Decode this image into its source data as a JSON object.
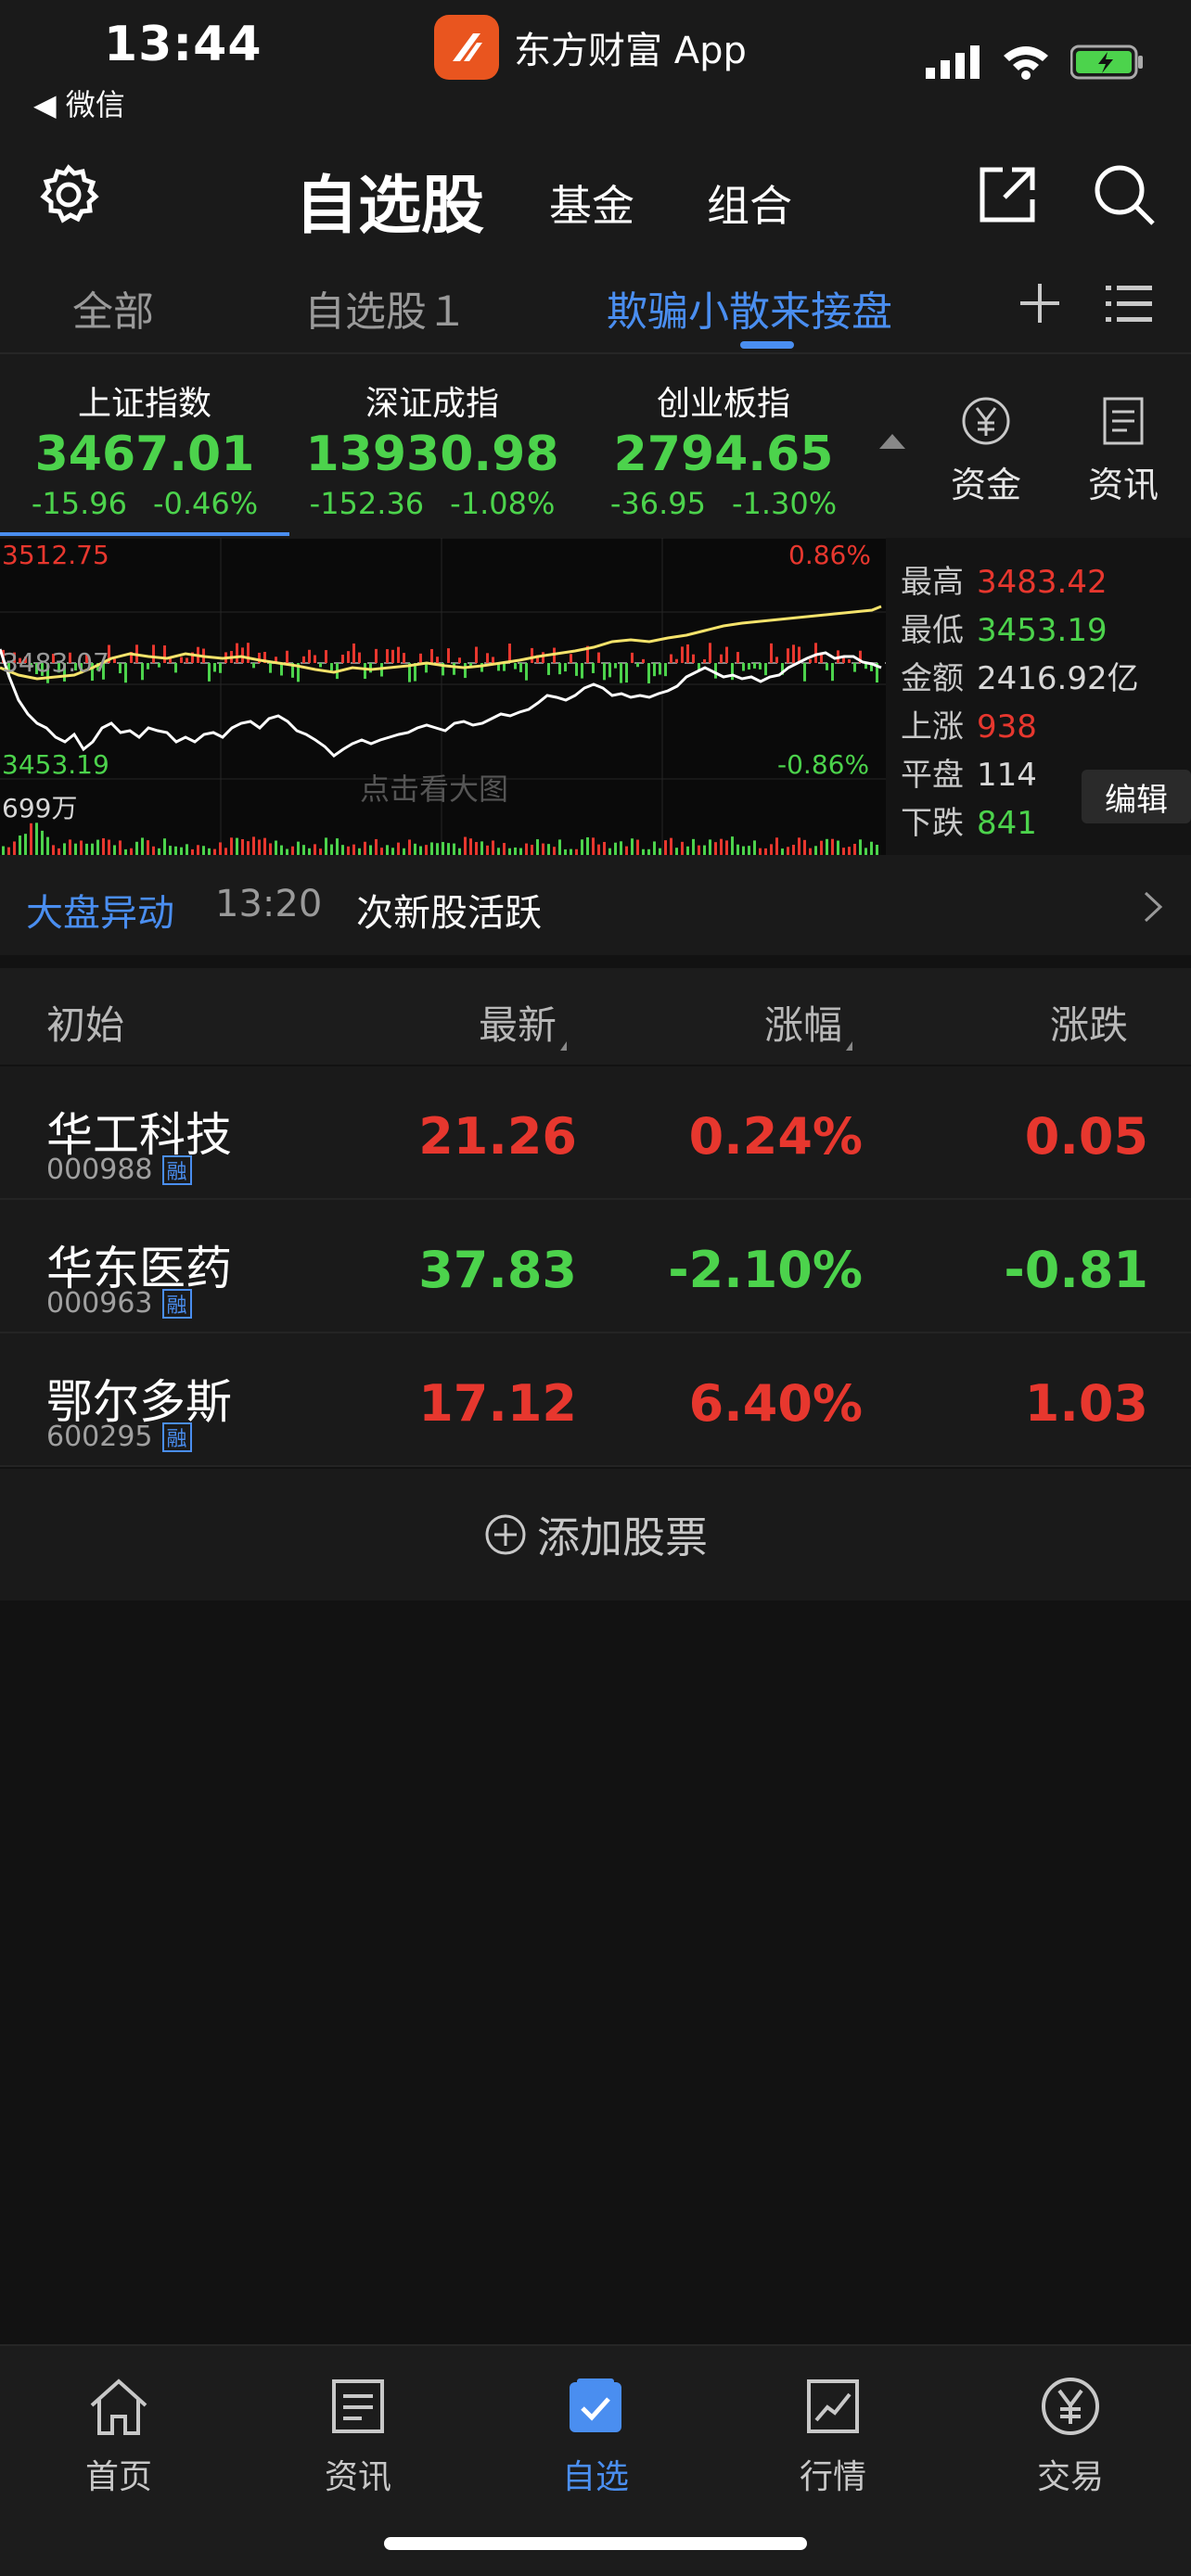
{
  "status_bar": {
    "time": "13:44",
    "back_label": "◀ 微信",
    "app_name": "东方财富 App"
  },
  "nav": {
    "title": "自选股",
    "tab_fund": "基金",
    "tab_portfolio": "组合"
  },
  "groups": {
    "all": "全部",
    "watch1": "自选股１",
    "active": "欺骗小散来接盘"
  },
  "indices": [
    {
      "name": "上证指数",
      "value": "3467.01",
      "change": "-15.96",
      "pct": "-0.46%"
    },
    {
      "name": "深证成指",
      "value": "13930.98",
      "change": "-152.36",
      "pct": "-1.08%"
    },
    {
      "name": "创业板指",
      "value": "2794.65",
      "change": "-36.95",
      "pct": "-1.30%"
    }
  ],
  "side_buttons": {
    "funds": "资金",
    "news": "资讯"
  },
  "chart": {
    "high_label": "3512.75",
    "mid_label": "3483.07",
    "low_label": "3453.19",
    "pct_high": "0.86%",
    "pct_low": "-0.86%",
    "volume_label": "699万",
    "hint": "点击看大图"
  },
  "stats": {
    "high": {
      "label": "最高",
      "value": "3483.42"
    },
    "low": {
      "label": "最低",
      "value": "3453.19"
    },
    "amount": {
      "label": "金额",
      "value": "2416.92亿"
    },
    "up": {
      "label": "上涨",
      "value": "938"
    },
    "flat": {
      "label": "平盘",
      "value": "114"
    },
    "down": {
      "label": "下跌",
      "value": "841"
    },
    "edit_label": "编辑"
  },
  "alert": {
    "tag": "大盘异动",
    "time": "13:20",
    "text": "次新股活跃"
  },
  "list_header": {
    "name": "初始",
    "latest": "最新",
    "pct": "涨幅",
    "change": "涨跌"
  },
  "stocks": [
    {
      "name": "华工科技",
      "code": "000988",
      "badge": "融",
      "price": "21.26",
      "pct": "0.24%",
      "change": "0.05",
      "color": "#e7372e"
    },
    {
      "name": "华东医药",
      "code": "000963",
      "badge": "融",
      "price": "37.83",
      "pct": "-2.10%",
      "change": "-0.81",
      "color": "#4cd34c"
    },
    {
      "name": "鄂尔多斯",
      "code": "600295",
      "badge": "融",
      "price": "17.12",
      "pct": "6.40%",
      "change": "1.03",
      "color": "#e7372e"
    }
  ],
  "add_stock_label": "添加股票",
  "tabbar": {
    "home": "首页",
    "news": "资讯",
    "watchlist": "自选",
    "market": "行情",
    "trade": "交易"
  },
  "colors": {
    "up": "#e7372e",
    "down": "#4cd34c",
    "accent": "#4a8ef0",
    "brand": "#e9551f"
  }
}
